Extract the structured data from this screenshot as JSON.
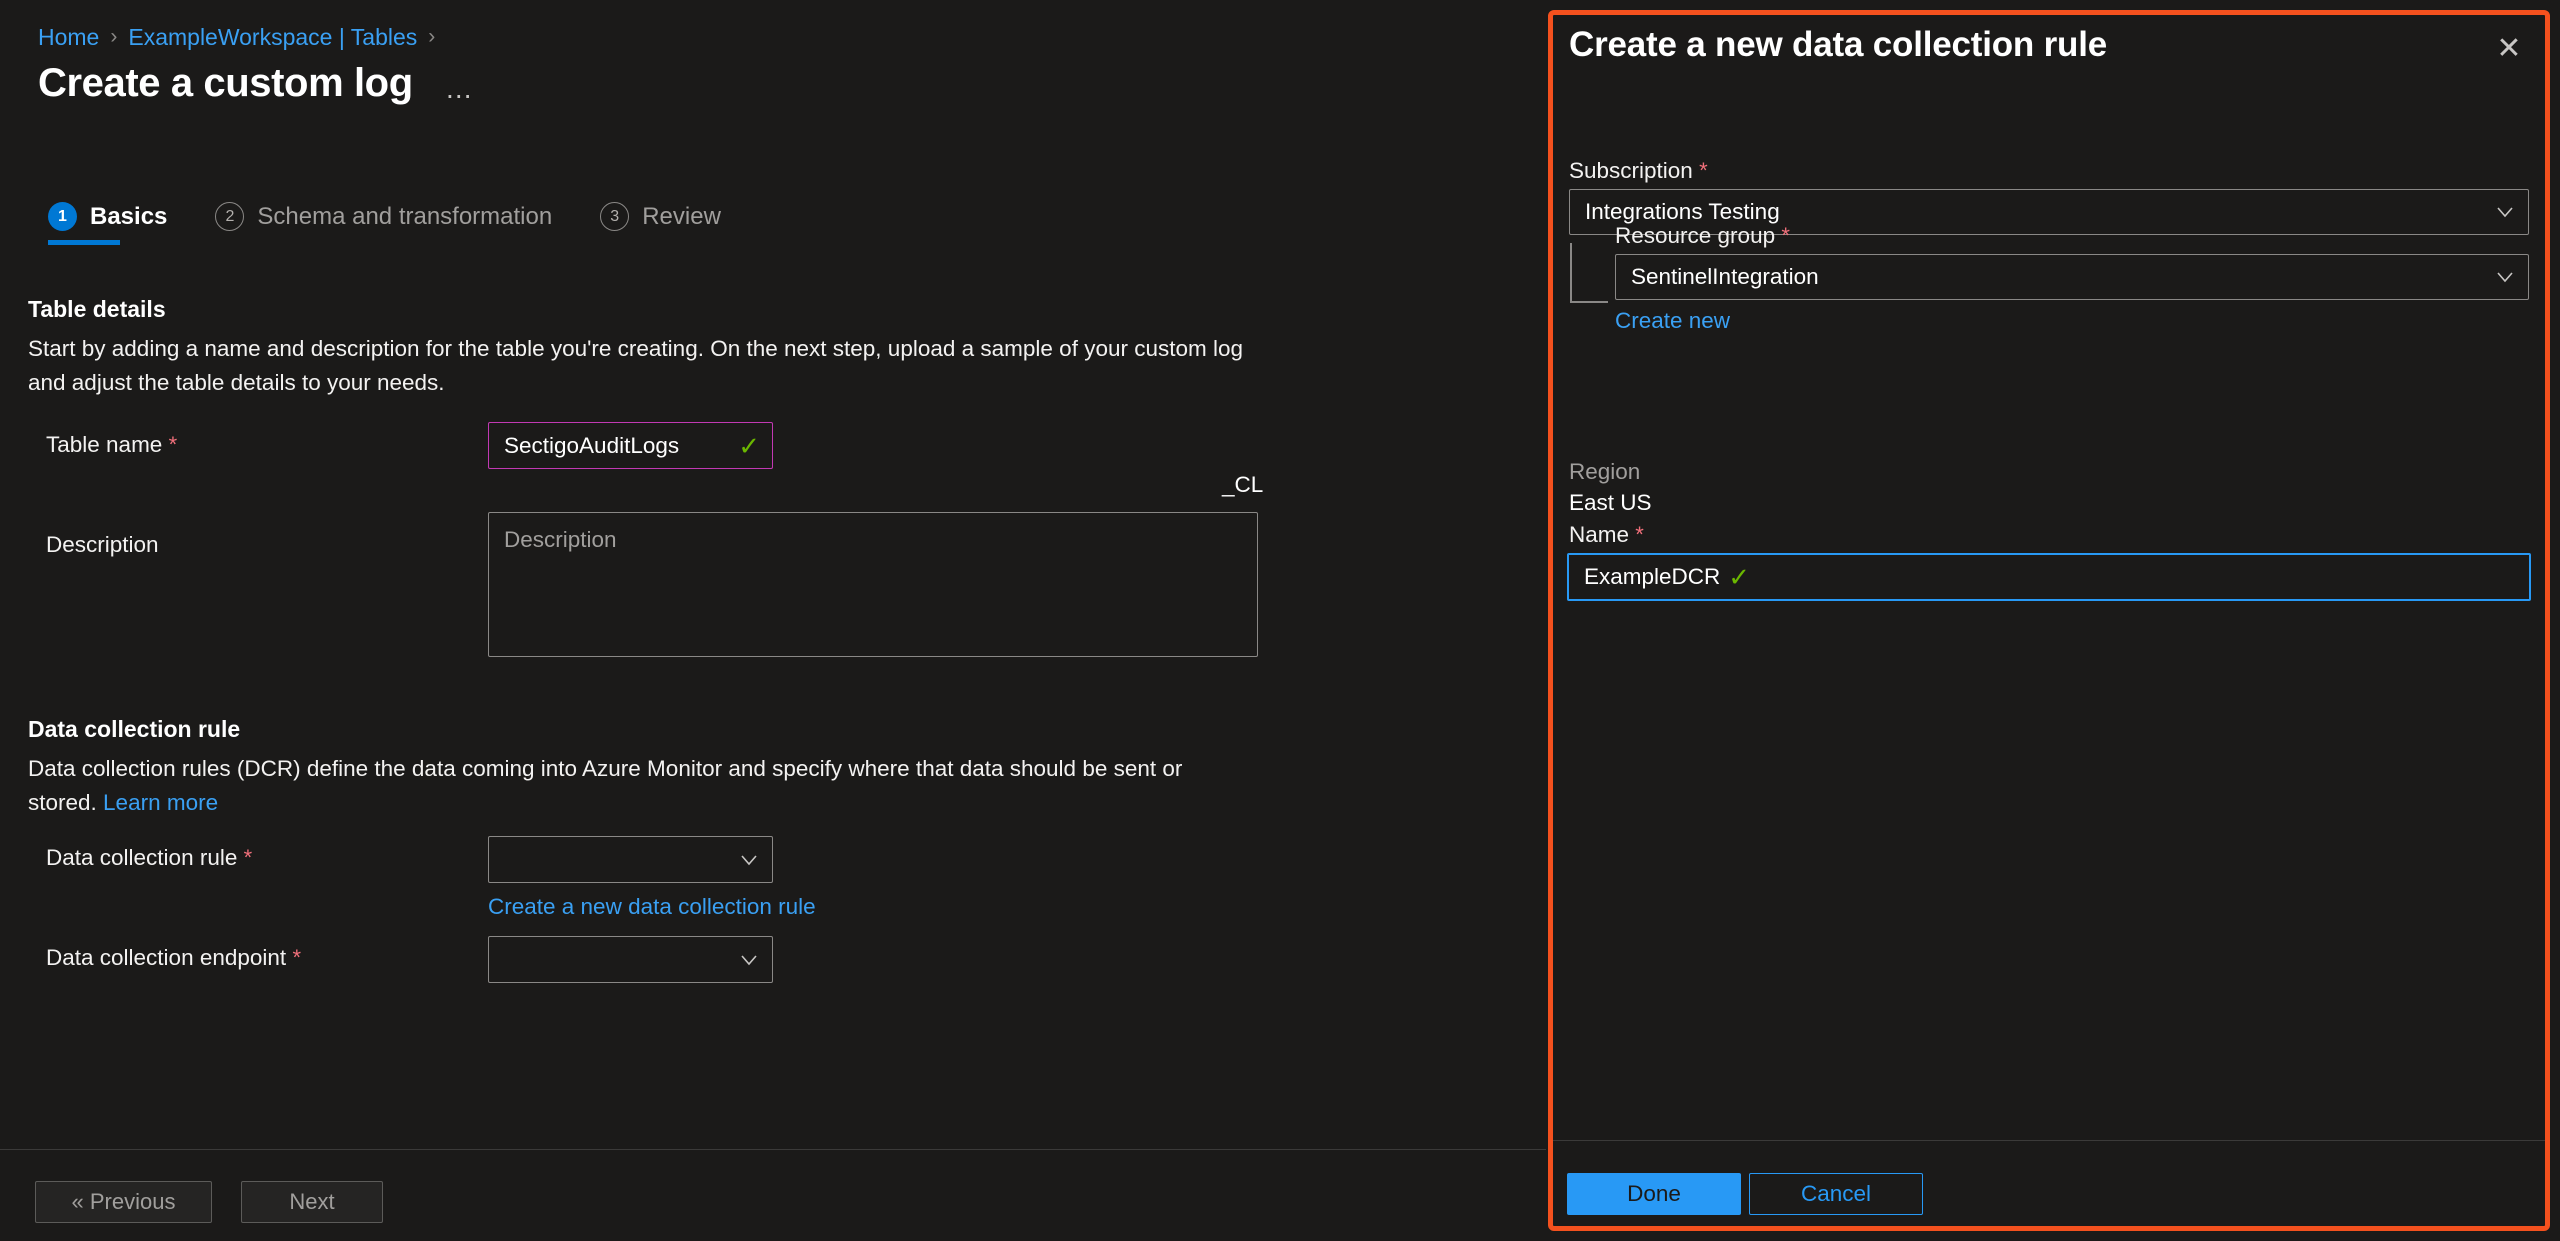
{
  "colors": {
    "background": "#1b1a19",
    "accent_blue": "#0078d4",
    "link_blue": "#3aa0f3",
    "highlight_border": "#f4511e",
    "valid_magenta": "#c239b3",
    "check_green": "#6bb700",
    "required_red": "#f1707b",
    "focus_blue": "#2899f5"
  },
  "breadcrumb": {
    "items": [
      {
        "label": "Home",
        "icon": "chevron-right-icon"
      },
      {
        "label": "ExampleWorkspace | Tables",
        "icon": "chevron-right-icon"
      }
    ],
    "separator": "›"
  },
  "header": {
    "title": "Create a custom log",
    "more_label": "…"
  },
  "wizard": {
    "steps": [
      {
        "number": "1",
        "label": "Basics",
        "state": "active"
      },
      {
        "number": "2",
        "label": "Schema and transformation",
        "state": "inactive"
      },
      {
        "number": "3",
        "label": "Review",
        "state": "inactive"
      }
    ]
  },
  "table_details": {
    "heading": "Table details",
    "description": "Start by adding a name and description for the table you're creating. On the next step, upload a sample of your custom log and adjust the table details to your needs.",
    "table_name": {
      "label": "Table name",
      "required": "*",
      "value": "SectigoAuditLogs",
      "suffix": "_CL",
      "validation_icon": "checkmark-icon"
    },
    "description_field": {
      "label": "Description",
      "value": "",
      "placeholder": "Description"
    }
  },
  "dcr_section": {
    "heading": "Data collection rule",
    "description_part1": "Data collection rules (DCR) define the data coming into Azure Monitor and specify where that data should be sent or stored. ",
    "learn_more": "Learn more",
    "rule_field": {
      "label": "Data collection rule",
      "required": "*",
      "value": "",
      "chevron": "chevron-down-icon"
    },
    "create_link": "Create a new data collection rule",
    "endpoint_field": {
      "label": "Data collection endpoint",
      "required": "*",
      "value": "",
      "chevron": "chevron-down-icon"
    }
  },
  "wizard_footer": {
    "previous": "« Previous",
    "next": "Next"
  },
  "panel": {
    "title": "Create a new data collection rule",
    "close_icon": "close-icon",
    "subscription": {
      "label": "Subscription",
      "required": "*",
      "value": "Integrations Testing",
      "chevron": "chevron-down-icon"
    },
    "resource_group": {
      "label": "Resource group",
      "required": "*",
      "value": "SentinelIntegration",
      "chevron": "chevron-down-icon",
      "create_new": "Create new"
    },
    "region": {
      "label": "Region",
      "value": "East US"
    },
    "name": {
      "label": "Name",
      "required": "*",
      "value": "ExampleDCR",
      "validation_icon": "checkmark-icon"
    },
    "footer": {
      "done": "Done",
      "cancel": "Cancel"
    }
  }
}
